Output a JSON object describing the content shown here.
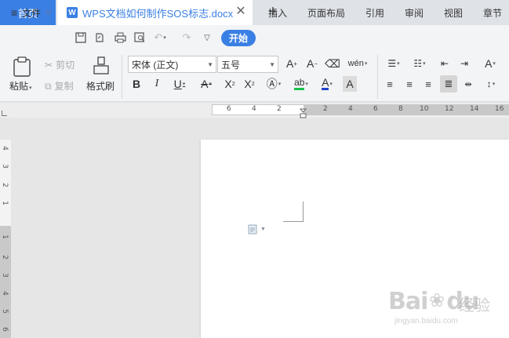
{
  "tabs": {
    "home_label": "首页",
    "doc_icon": "W",
    "doc_title": "WPS文档如何制作SOS标志.docx",
    "close_glyph": "✕",
    "add_glyph": "+"
  },
  "menu": {
    "file_label": "文件",
    "items": [
      "开始",
      "插入",
      "页面布局",
      "引用",
      "审阅",
      "视图",
      "章节"
    ]
  },
  "ribbon": {
    "paste_label": "粘贴",
    "cut_label": "剪切",
    "copy_label": "复制",
    "format_painter_label": "格式刷",
    "font_name": "宋体 (正文)",
    "font_size": "五号"
  },
  "ruler": {
    "h_numbers": [
      "6",
      "4",
      "2",
      "2",
      "4",
      "6",
      "8",
      "10",
      "12",
      "14",
      "16"
    ],
    "v_numbers": [
      "4",
      "3",
      "2",
      "1",
      "1",
      "2",
      "3",
      "4",
      "5",
      "6"
    ]
  },
  "watermark": {
    "brand": "Bai",
    "brand2": "du",
    "cn": "经验",
    "url": "jingyan.baidu.com"
  },
  "colors": {
    "accent": "#3a7fe4",
    "highlight_green": "#19c34a",
    "font_red": "#d22222",
    "font_blue": "#2244cc"
  }
}
